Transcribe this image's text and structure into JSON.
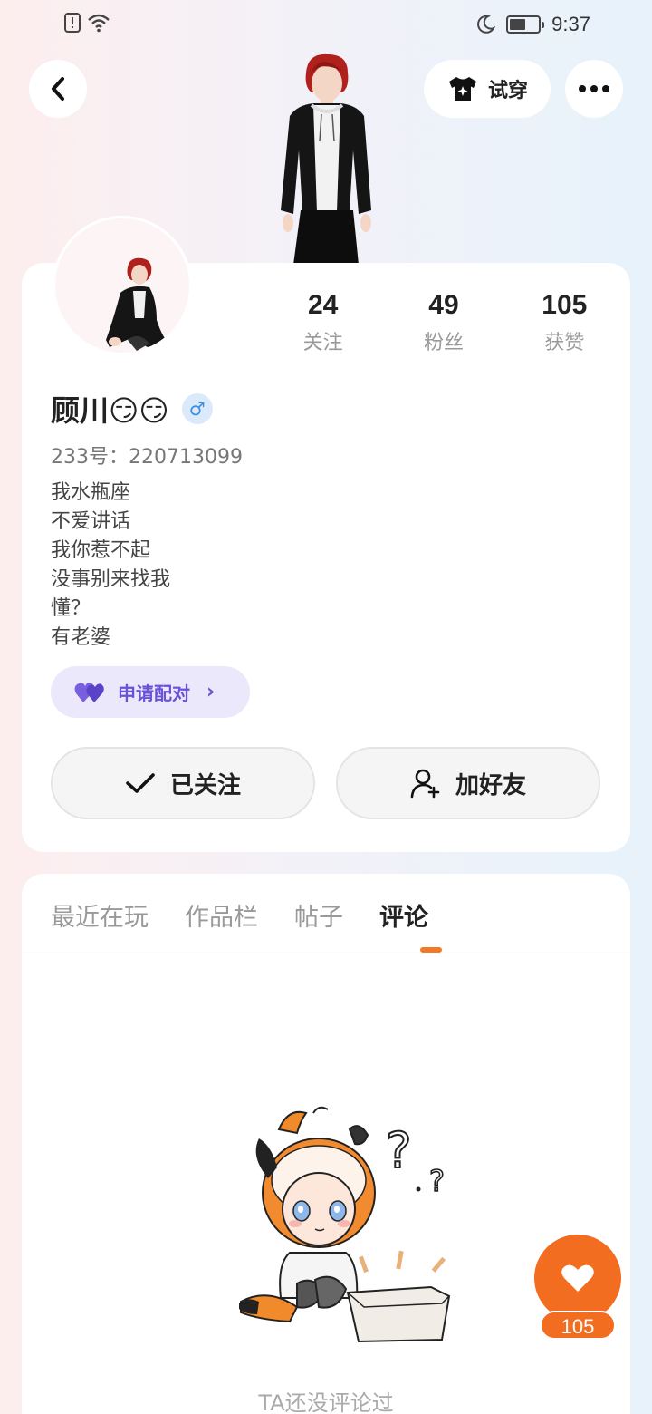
{
  "status_bar": {
    "time": "9:37",
    "battery_level": 0.5,
    "icons": [
      "sim-alert-icon",
      "wifi-icon",
      "moon-icon",
      "battery-icon"
    ]
  },
  "header": {
    "tryon_label": "试穿",
    "icons": [
      "back-icon",
      "shirt-sparkle-icon",
      "more-icon"
    ]
  },
  "profile": {
    "name": "顾川😏😏",
    "gender_symbol": "♂",
    "uid": "233号：220713099",
    "bio": [
      "我水瓶座",
      "不爱讲话",
      "我你惹不起",
      "没事别来找我",
      "懂？",
      "有老婆"
    ],
    "stats": [
      {
        "value": "24",
        "label": "关注"
      },
      {
        "value": "49",
        "label": "粉丝"
      },
      {
        "value": "105",
        "label": "获赞"
      }
    ],
    "pair_label": "申请配对",
    "followed_label": "已关注",
    "add_friend_label": "加好友"
  },
  "tabs": [
    {
      "label": "最近在玩",
      "active": false
    },
    {
      "label": "作品栏",
      "active": false
    },
    {
      "label": "帖子",
      "active": false
    },
    {
      "label": "评论",
      "active": true
    }
  ],
  "empty_state": {
    "text": "TA还没评论过"
  },
  "like": {
    "count": "105"
  },
  "colors": {
    "accent_orange": "#f26d1f",
    "pair_purple": "#6a52d6",
    "gender_blue": "#3a8de0"
  }
}
